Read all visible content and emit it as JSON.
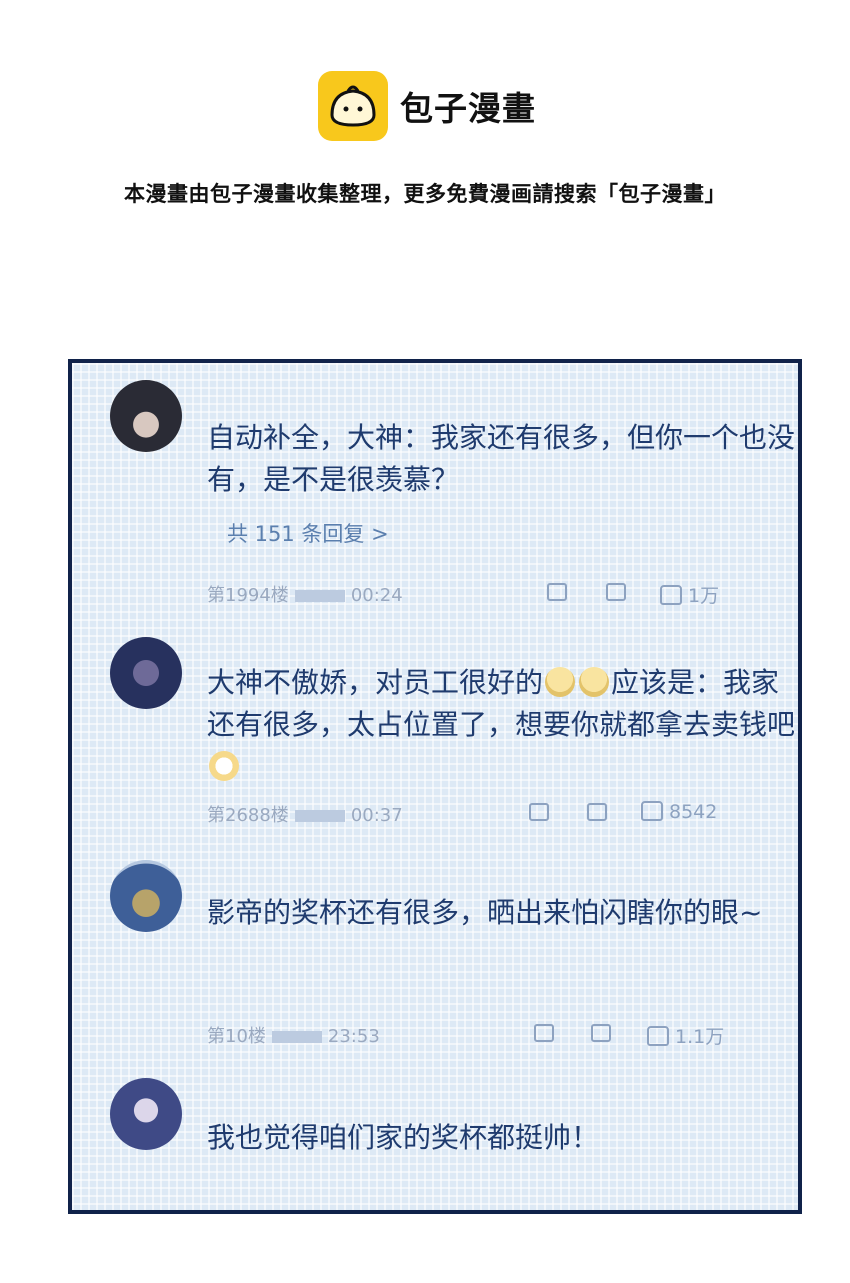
{
  "brand": {
    "name": "包子漫畫"
  },
  "notice": "本漫畫由包子漫畫收集整理，更多免費漫画請搜索「包子漫畫」",
  "comments": [
    {
      "text": "自动补全，大神：我家还有很多，但你一个也没有，是不是很羡慕？",
      "replies": "共 151 条回复 >",
      "floor": "第1994楼",
      "time": "00:24",
      "likes": "1万"
    },
    {
      "text_a": "大神不傲娇，对员工很好的",
      "text_b": "应该是：我家还有很多，太占位置了，想要你就都拿去卖钱吧",
      "floor": "第2688楼",
      "time": "00:37",
      "likes": "8542"
    },
    {
      "text": "影帝的奖杯还有很多，晒出来怕闪瞎你的眼~",
      "floor": "第10楼",
      "time": "23:53",
      "likes": "1.1万"
    },
    {
      "text": "我也觉得咱们家的奖杯都挺帅！"
    }
  ],
  "icons": [
    "share-icon",
    "comment-icon",
    "thumbs-up-icon",
    "emoji-shy-icon",
    "emoji-grin-icon"
  ],
  "colors": {
    "brand_yellow": "#f8c81c",
    "panel_border": "#10224a",
    "comment_text": "#1f3b6e"
  }
}
